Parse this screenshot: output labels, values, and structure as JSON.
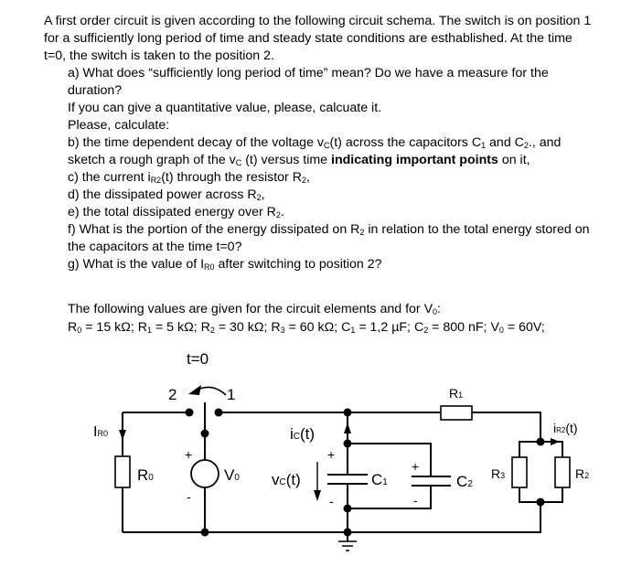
{
  "problem": {
    "intro": [
      "A first order circuit is given according to the following circuit schema. The switch is on position 1",
      "for a sufficiently long period of time and steady state conditions are esthablished. At the time",
      "t=0, the switch is taken to the position 2."
    ],
    "questions": {
      "a_line1": "a) What does “sufficiently long period of time” mean? Do we have a measure for the",
      "a_line2": "duration?",
      "a_line3": "If you can give a quantitative value, please, calcuate it.",
      "please": "Please, calculate:",
      "b_pre": "b) the time dependent decay of the voltage v",
      "b_sub": "C",
      "b_mid": "(t) across the capacitors C",
      "b_sub1": "1",
      "b_mid2": " and C",
      "b_sub2": "2",
      "b_end": "., and",
      "b2_pre": "sketch a rough graph of the v",
      "b2_sub": "C",
      "b2_mid": " (t) versus time ",
      "b2_bold": "indicating important points",
      "b2_end": " on it,",
      "c_pre": "c) the current i",
      "c_sub": "R2",
      "c_end": "(t) through the resistor R",
      "c_sub2": "2",
      "c_tail": ",",
      "d_pre": "d) the dissipated power across R",
      "d_sub": "2",
      "d_tail": ",",
      "e_pre": "e) the total dissipated energy over R",
      "e_sub": "2",
      "e_tail": ".",
      "f_pre": "f) What is the portion of the energy dissipated on R",
      "f_sub": "2",
      "f_end": " in relation to the total energy stored on",
      "f_line2": "the capacitors at the time t=0?",
      "g_pre": "g) What is the value of I",
      "g_sub": "R0",
      "g_end": " after switching to position 2?"
    },
    "values_intro_pre": "The following values are given for the circuit elements and for V",
    "values_intro_sub": "0",
    "values_intro_end": ":",
    "values": [
      {
        "name": "R",
        "sub": "0",
        "value": " = 15 kΩ; "
      },
      {
        "name": "R",
        "sub": "1",
        "value": " = 5 kΩ; "
      },
      {
        "name": "R",
        "sub": "2",
        "value": " = 30 kΩ; "
      },
      {
        "name": "R",
        "sub": "3",
        "value": " = 60 kΩ; "
      },
      {
        "name": "C",
        "sub": "1",
        "value": " = 1,2 µF; "
      },
      {
        "name": "C",
        "sub": "2",
        "value": " = 800 nF; "
      },
      {
        "name": "V",
        "sub": "0",
        "value": " = 60V;"
      }
    ]
  },
  "circuit": {
    "switch_time": "t=0",
    "switch_pos2": "2",
    "switch_pos1": "1",
    "labels": {
      "iR0_main": "I",
      "iR0_sub": "R0",
      "R0_main": "R",
      "R0_sub": "0",
      "V0_main": "V",
      "V0_sub": "0",
      "ic_main": "i",
      "ic_sub": "C",
      "ic_end": "(t)",
      "vc_main": "v",
      "vc_sub": "C",
      "vc_end": "(t)",
      "C1_main": "C",
      "C1_sub": "1",
      "C2_main": "C",
      "C2_sub": "2",
      "R1_main": "R",
      "R1_sub": "1",
      "R2_main": "R",
      "R2_sub": "2",
      "R3_main": "R",
      "R3_sub": "3",
      "iR2_main": "i",
      "iR2_sub": "R2",
      "iR2_end": "(t)",
      "plus": "+",
      "minus": "-"
    }
  }
}
